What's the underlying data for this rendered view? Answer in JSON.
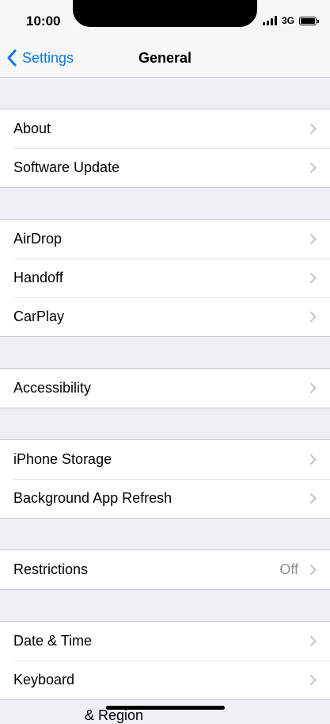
{
  "status_bar": {
    "time": "10:00",
    "network": "3G"
  },
  "nav": {
    "back_label": "Settings",
    "title": "General"
  },
  "groups": [
    [
      {
        "label": "About"
      },
      {
        "label": "Software Update"
      }
    ],
    [
      {
        "label": "AirDrop"
      },
      {
        "label": "Handoff"
      },
      {
        "label": "CarPlay"
      }
    ],
    [
      {
        "label": "Accessibility"
      }
    ],
    [
      {
        "label": "iPhone Storage"
      },
      {
        "label": "Background App Refresh"
      }
    ],
    [
      {
        "label": "Restrictions",
        "value": "Off"
      }
    ],
    [
      {
        "label": "Date & Time"
      },
      {
        "label": "Keyboard"
      }
    ]
  ],
  "partial_row_label": "& Region",
  "colors": {
    "accent": "#007aff",
    "background": "#efeff4",
    "separator": "#c8c7cc"
  }
}
